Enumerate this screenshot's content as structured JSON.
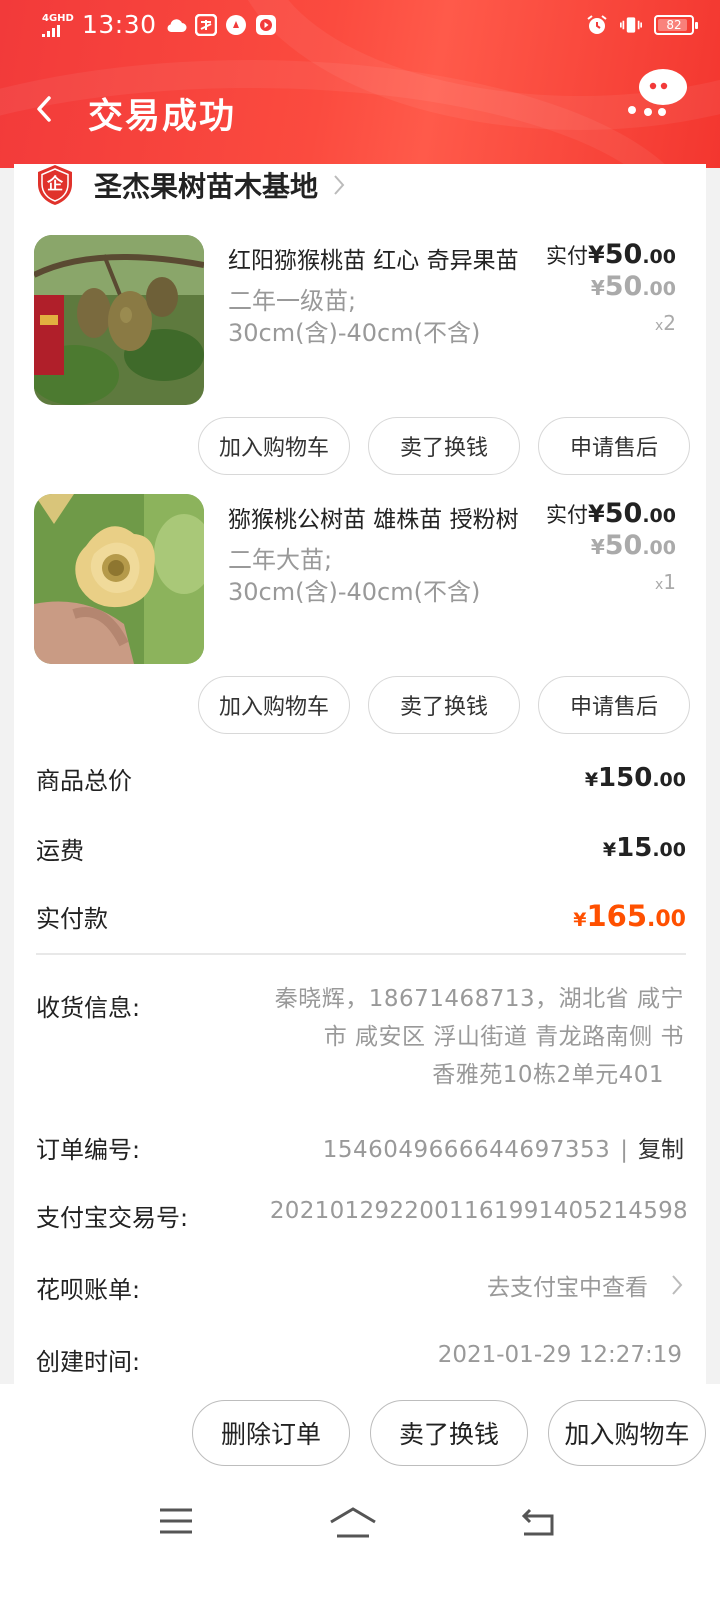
{
  "status_bar": {
    "network": "4GHD",
    "time": "13:30",
    "battery": "82"
  },
  "header": {
    "title": "交易成功"
  },
  "shop": {
    "name": "圣杰果树苗木基地",
    "badge": "企"
  },
  "items": [
    {
      "title": "红阳猕猴桃苗  红心  奇异果苗",
      "spec_line1": "二年一级苗;",
      "spec_line2": "30cm(含)-40cm(不含)",
      "paid_label": "实付",
      "currency": "¥",
      "paid_int": "50",
      "paid_dec": ".00",
      "price_int": "50",
      "price_dec": ".00",
      "qty_prefix": "x",
      "qty": "2"
    },
    {
      "title": "猕猴桃公树苗  雄株苗  授粉树",
      "spec_line1": "二年大苗;",
      "spec_line2": "30cm(含)-40cm(不含)",
      "paid_label": "实付",
      "currency": "¥",
      "paid_int": "50",
      "paid_dec": ".00",
      "price_int": "50",
      "price_dec": ".00",
      "qty_prefix": "x",
      "qty": "1"
    }
  ],
  "item_actions": {
    "add_cart": "加入购物车",
    "sell": "卖了换钱",
    "after_sale": "申请售后"
  },
  "summary": {
    "goods_total_label": "商品总价",
    "goods_total_int": "150",
    "goods_total_dec": ".00",
    "shipping_label": "运费",
    "shipping_int": "15",
    "shipping_dec": ".00",
    "paid_label": "实付款",
    "paid_int": "165",
    "paid_dec": ".00",
    "currency": "¥"
  },
  "info": {
    "receiver_label": "收货信息:",
    "receiver_line1": "秦晓辉，18671468713，湖北省  咸宁",
    "receiver_line2": "市  咸安区  浮山街道  青龙路南侧  书",
    "receiver_line3": "香雅苑10栋2单元401",
    "order_no_label": "订单编号:",
    "order_no": "1546049666644697353",
    "separator": "|",
    "copy": "复制",
    "alipay_no_label": "支付宝交易号:",
    "alipay_no": "2021012922001161991405214598",
    "huabei_label": "花呗账单:",
    "huabei_link": "去支付宝中查看",
    "created_label": "创建时间:",
    "created_time": "2021-01-29  12:27:19"
  },
  "bottom_actions": {
    "delete": "删除订单",
    "sell": "卖了换钱",
    "add_cart": "加入购物车"
  },
  "colors": {
    "header_red": "#f23a3a",
    "price_orange": "#ff5000",
    "shop_badge": "#e0322b"
  }
}
